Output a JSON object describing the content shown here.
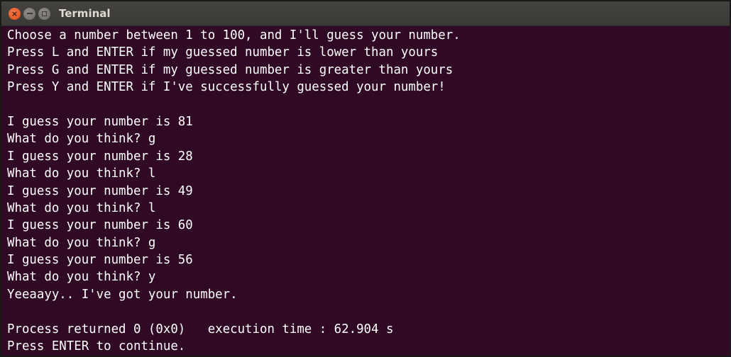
{
  "window": {
    "title": "Terminal"
  },
  "terminal": {
    "lines": [
      "Choose a number between 1 to 100, and I'll guess your number.",
      "Press L and ENTER if my guessed number is lower than yours",
      "Press G and ENTER if my guessed number is greater than yours",
      "Press Y and ENTER if I've successfully guessed your number!",
      "",
      "I guess your number is 81",
      "What do you think? g",
      "I guess your number is 28",
      "What do you think? l",
      "I guess your number is 49",
      "What do you think? l",
      "I guess your number is 60",
      "What do you think? g",
      "I guess your number is 56",
      "What do you think? y",
      "Yeeaayy.. I've got your number.",
      "",
      "Process returned 0 (0x0)   execution time : 62.904 s",
      "Press ENTER to continue."
    ]
  },
  "colors": {
    "background": "#300a24",
    "text": "#ffffff",
    "titlebar": "#3c3b37",
    "close_button": "#df4a16"
  }
}
